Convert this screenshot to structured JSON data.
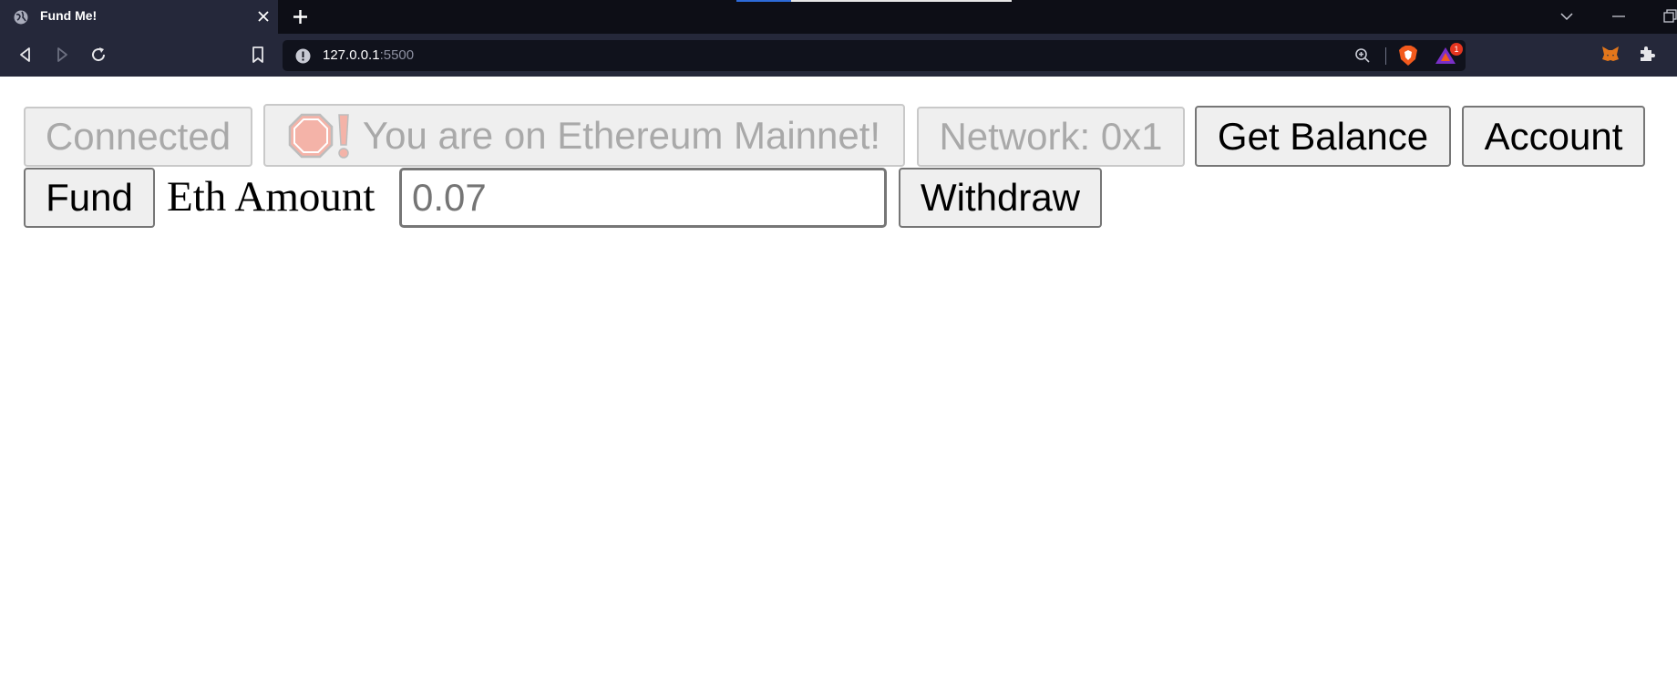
{
  "browser": {
    "tab_title": "Fund Me!",
    "url_host": "127.0.0.1",
    "url_port": ":5500",
    "rewards_badge": "1"
  },
  "page": {
    "connect_button": "Connected",
    "network_warning": "You are on Ethereum Mainnet!",
    "network_id_button": "Network: 0x1",
    "get_balance_button": "Get Balance",
    "account_button": "Account",
    "fund_button": "Fund",
    "eth_amount_label": "Eth Amount",
    "eth_amount_placeholder": "0.07",
    "withdraw_button": "Withdraw"
  },
  "icons": {
    "warning_stop": "stop-sign-icon",
    "warning_exclamation": "exclamation-icon"
  },
  "colors": {
    "tabbar_bg": "#0d0e16",
    "toolbar_bg": "#25283a",
    "stop_sign": "#f4b3a8",
    "disabled_text": "#a9a9a9"
  }
}
